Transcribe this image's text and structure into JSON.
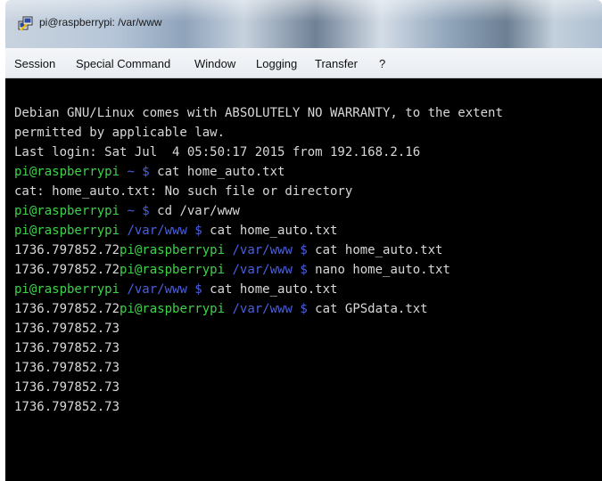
{
  "window": {
    "title": "pi@raspberrypi: /var/www"
  },
  "menu": {
    "items": [
      {
        "label": "Session"
      },
      {
        "label": "Special Command"
      },
      {
        "label": "Window"
      },
      {
        "label": "Logging"
      },
      {
        "label": "Transfer"
      },
      {
        "label": "?"
      }
    ]
  },
  "terminal": {
    "lines": [
      {
        "pre": "Debian GNU/Linux comes with ABSOLUTELY NO WARRANTY, to the extent"
      },
      {
        "pre": "permitted by applicable law."
      },
      {
        "pre": "Last login: Sat Jul  4 05:50:17 2015 from 192.168.2.16"
      },
      {
        "pre": "",
        "user": "pi@raspberrypi",
        "path": " ~",
        "dollar": " $",
        "cmd": " cat home_auto.txt"
      },
      {
        "pre": "cat: home_auto.txt: No such file or directory"
      },
      {
        "pre": "",
        "user": "pi@raspberrypi",
        "path": " ~",
        "dollar": " $",
        "cmd": " cd /var/www"
      },
      {
        "pre": "",
        "user": "pi@raspberrypi",
        "path": " /var/www",
        "dollar": " $",
        "cmd": " cat home_auto.txt"
      },
      {
        "pre": "1736.797852.72",
        "user": "pi@raspberrypi",
        "path": " /var/www",
        "dollar": " $",
        "cmd": " cat home_auto.txt"
      },
      {
        "pre": "1736.797852.72",
        "user": "pi@raspberrypi",
        "path": " /var/www",
        "dollar": " $",
        "cmd": " nano home_auto.txt"
      },
      {
        "pre": "",
        "user": "pi@raspberrypi",
        "path": " /var/www",
        "dollar": " $",
        "cmd": " cat home_auto.txt"
      },
      {
        "pre": "1736.797852.72",
        "user": "pi@raspberrypi",
        "path": " /var/www",
        "dollar": " $",
        "cmd": " cat GPSdata.txt"
      },
      {
        "pre": "1736.797852.73"
      },
      {
        "pre": "1736.797852.73"
      },
      {
        "pre": "1736.797852.73"
      },
      {
        "pre": "1736.797852.73"
      },
      {
        "pre": "1736.797852.73"
      }
    ]
  }
}
